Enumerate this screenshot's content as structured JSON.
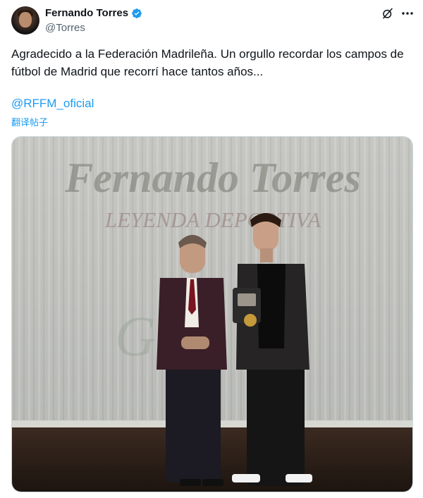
{
  "author": {
    "display_name": "Fernando Torres",
    "handle": "@Torres",
    "verified": true,
    "avatar_icon": "avatar-photo"
  },
  "header_icons": [
    "grok-icon",
    "more-icon"
  ],
  "tweet": {
    "text": "Agradecido a la Federación Madrileña. Un orgullo recordar los campos de fútbol de Madrid que recorrí hace tantos años...",
    "mention": "@RFFM_oficial",
    "translate_label": "翻译帖子"
  },
  "media": {
    "banner_title": "Fernando Torres",
    "banner_subtitle": "LEYENDA DEPORTIVA"
  },
  "colors": {
    "link": "#1d9bf0",
    "verified": "#1d9bf0",
    "secondary_text": "#536471"
  }
}
